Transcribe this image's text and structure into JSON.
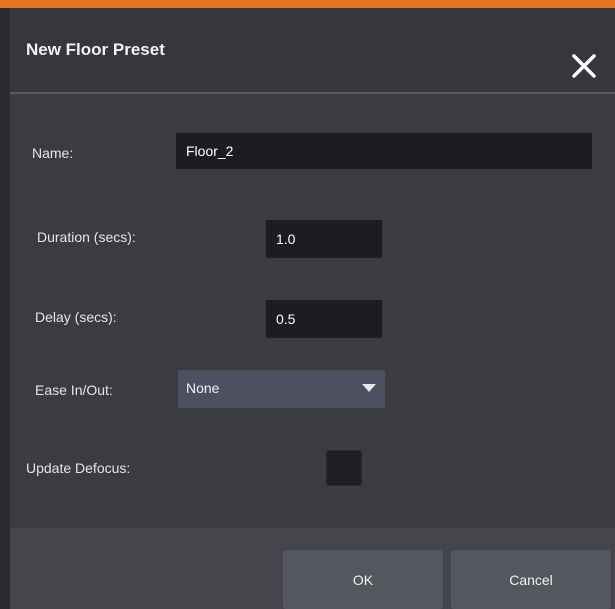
{
  "dialog": {
    "title": "New Floor Preset",
    "accent_color": "#e8731f",
    "close_icon": "close-icon"
  },
  "form": {
    "name": {
      "label": "Name:",
      "value": "Floor_2"
    },
    "duration": {
      "label": "Duration (secs):",
      "value": "1.0"
    },
    "delay": {
      "label": "Delay (secs):",
      "value": "0.5"
    },
    "ease": {
      "label": "Ease In/Out:",
      "selected": "None",
      "icon": "dropdown-arrow-icon"
    },
    "defocus": {
      "label": "Update Defocus:",
      "checked": false
    }
  },
  "buttons": {
    "ok_label": "OK",
    "cancel_label": "Cancel"
  }
}
